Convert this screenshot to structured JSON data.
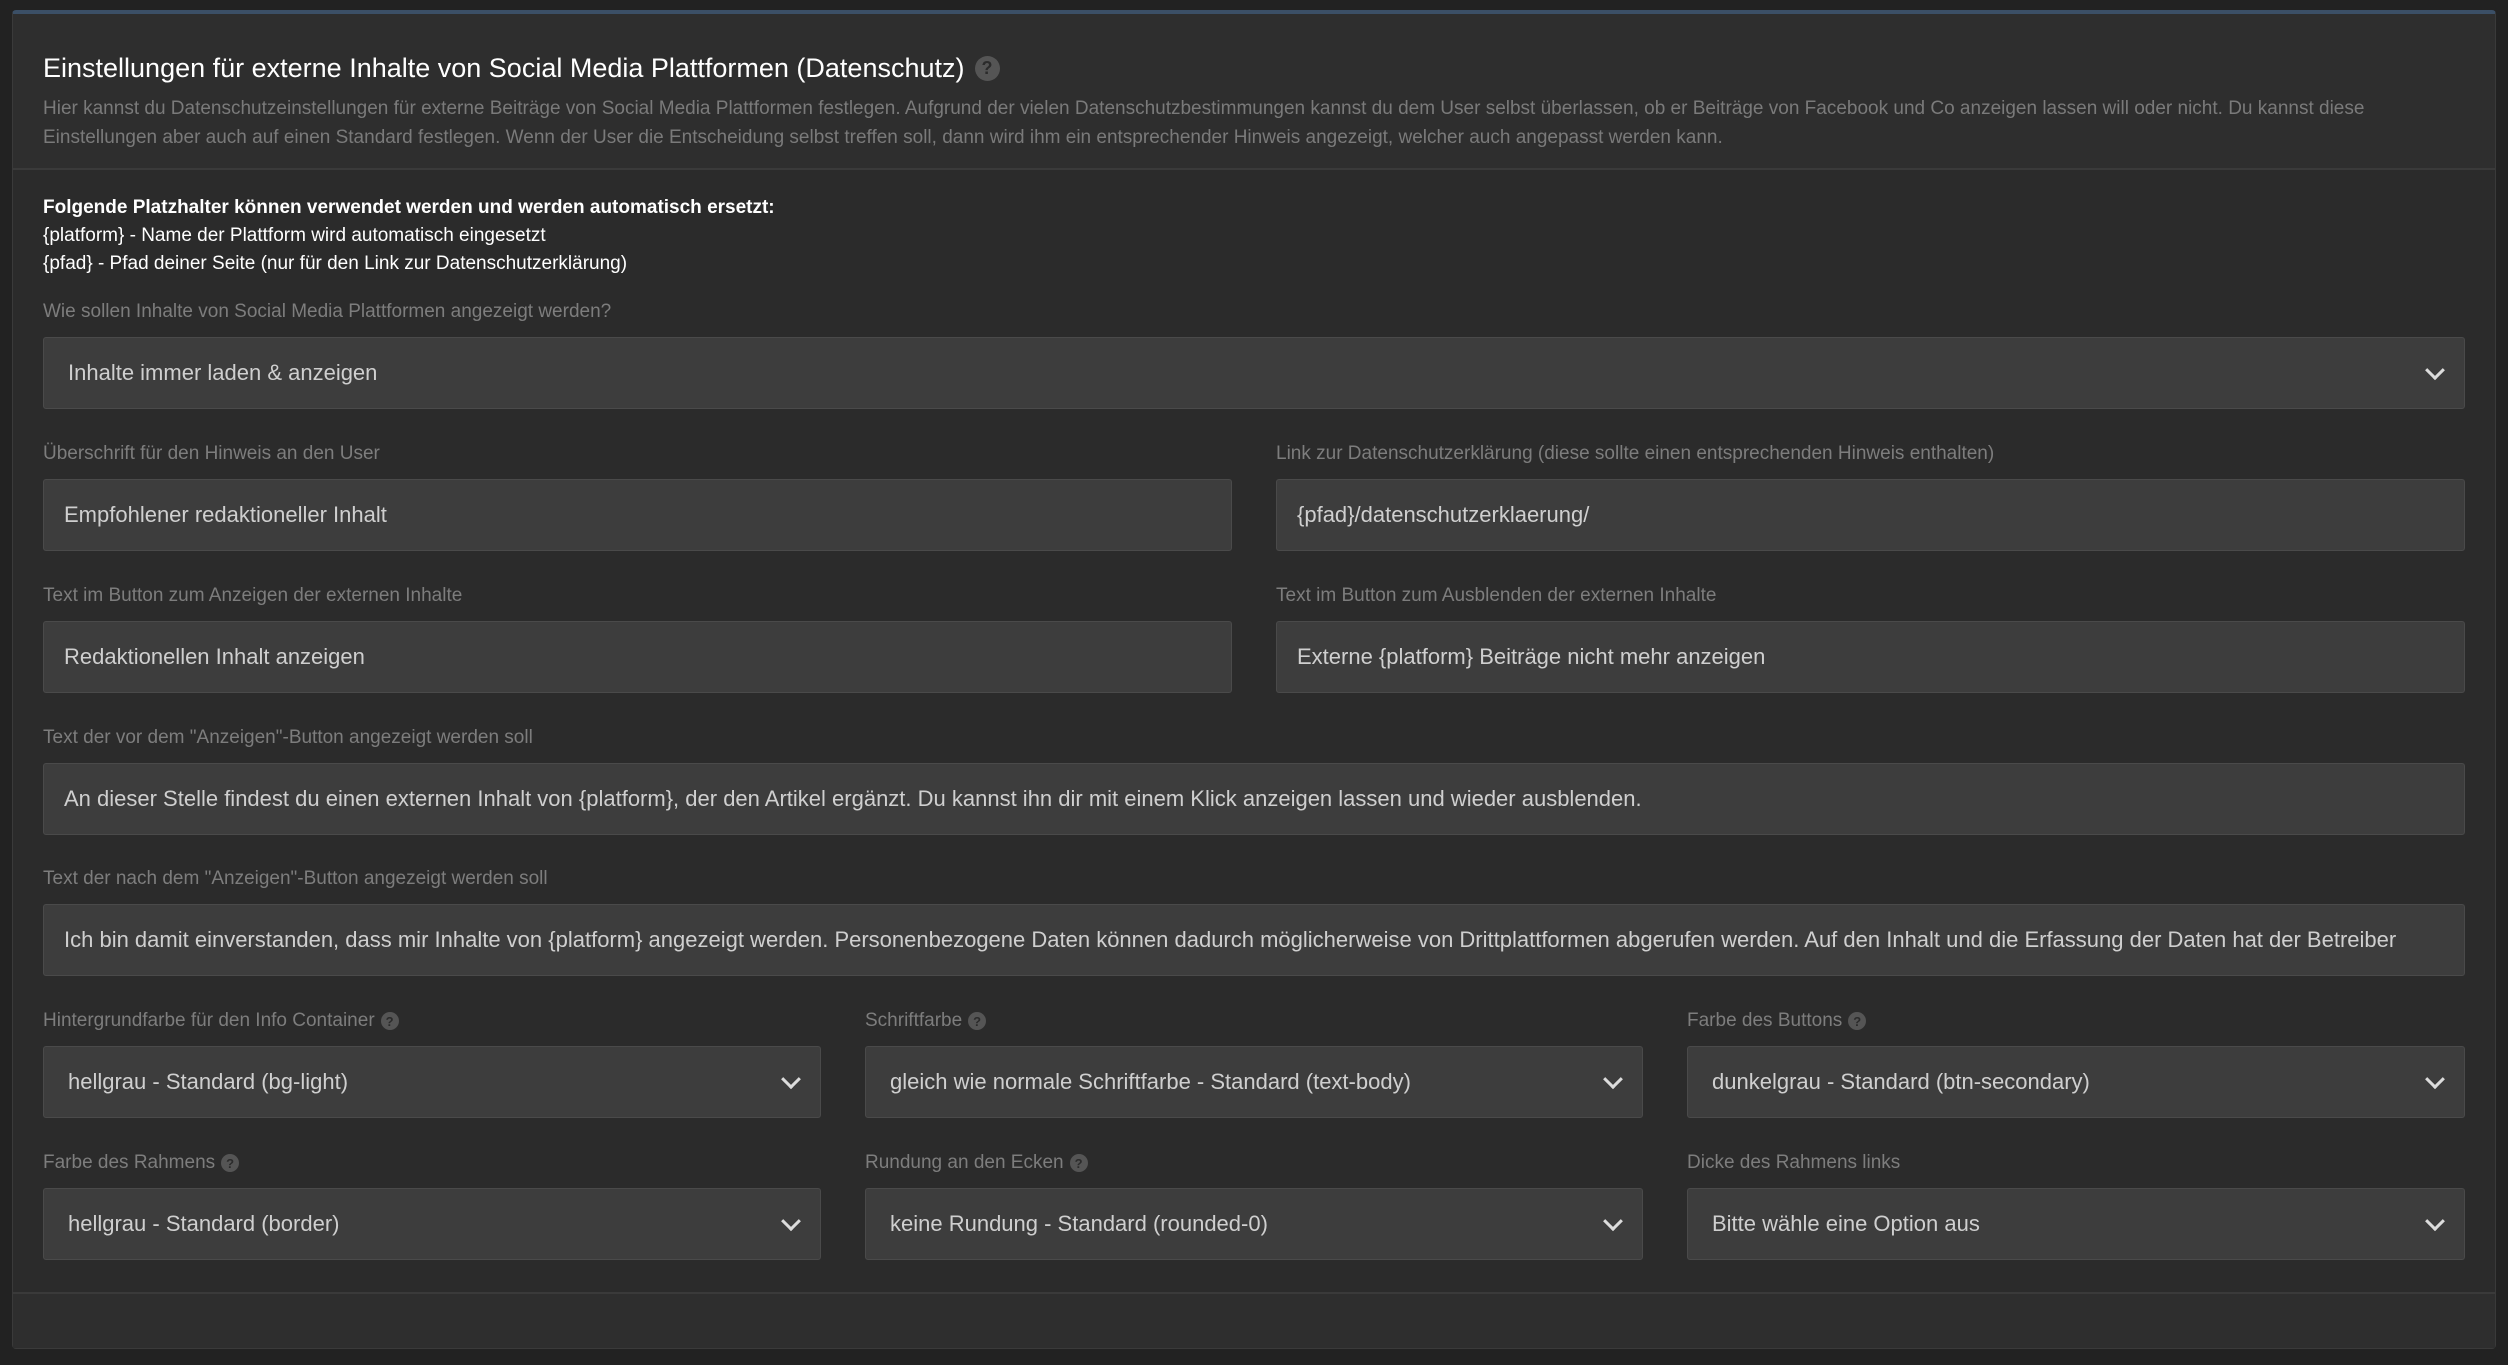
{
  "header": {
    "title": "Einstellungen für externe Inhalte von Social Media Plattformen (Datenschutz)",
    "description": "Hier kannst du Datenschutzeinstellungen für externe Beiträge von Social Media Plattformen festlegen. Aufgrund der vielen Datenschutzbestimmungen kannst du dem User selbst überlassen, ob er Beiträge von Facebook und Co anzeigen lassen will oder nicht. Du kannst diese Einstellungen aber auch auf einen Standard festlegen. Wenn der User die Entscheidung selbst treffen soll, dann wird ihm ein entsprechender Hinweis angezeigt, welcher auch angepasst werden kann."
  },
  "placeholders": {
    "title": "Folgende Platzhalter können verwendet werden und werden automatisch ersetzt:",
    "line1": "{platform} - Name der Plattform wird automatisch eingesetzt",
    "line2": "{pfad} - Pfad deiner Seite (nur für den Link zur Datenschutzerklärung)"
  },
  "display_mode": {
    "label": "Wie sollen Inhalte von Social Media Plattformen angezeigt werden?",
    "value": "Inhalte immer laden & anzeigen"
  },
  "notice_heading": {
    "label": "Überschrift für den Hinweis an den User",
    "value": "Empfohlener redaktioneller Inhalt"
  },
  "privacy_link": {
    "label": "Link zur Datenschutzerklärung (diese sollte einen entsprechenden Hinweis enthalten)",
    "value": "{pfad}/datenschutzerklaerung/"
  },
  "show_button_text": {
    "label": "Text im Button zum Anzeigen der externen Inhalte",
    "value": "Redaktionellen Inhalt anzeigen"
  },
  "hide_button_text": {
    "label": "Text im Button zum Ausblenden der externen Inhalte",
    "value": "Externe {platform} Beiträge nicht mehr anzeigen"
  },
  "text_before": {
    "label": "Text der vor dem \"Anzeigen\"-Button angezeigt werden soll",
    "value": "An dieser Stelle findest du einen externen Inhalt von {platform}, der den Artikel ergänzt. Du kannst ihn dir mit einem Klick anzeigen lassen und wieder ausblenden."
  },
  "text_after": {
    "label": "Text der nach dem \"Anzeigen\"-Button angezeigt werden soll",
    "value": "Ich bin damit einverstanden, dass mir Inhalte von {platform} angezeigt werden. Personenbezogene Daten können dadurch möglicherweise von Drittplattformen abgerufen werden. Auf den Inhalt und die Erfassung der Daten hat der Betreiber"
  },
  "bg_color": {
    "label": "Hintergrundfarbe für den Info Container",
    "value": "hellgrau - Standard (bg-light)"
  },
  "font_color": {
    "label": "Schriftfarbe",
    "value": "gleich wie normale Schriftfarbe - Standard (text-body)"
  },
  "button_color": {
    "label": "Farbe des Buttons",
    "value": "dunkelgrau - Standard (btn-secondary)"
  },
  "border_color": {
    "label": "Farbe des Rahmens",
    "value": "hellgrau - Standard (border)"
  },
  "rounding": {
    "label": "Rundung an den Ecken",
    "value": "keine Rundung - Standard (rounded-0)"
  },
  "border_width": {
    "label": "Dicke des Rahmens links",
    "value": "Bitte wähle eine Option aus"
  },
  "help_glyph": "?",
  "colors": {
    "background": "#222222",
    "card": "#2b2b2b",
    "field": "#3d3d3d",
    "label": "#7d7d7d",
    "title": "#ffffff"
  }
}
